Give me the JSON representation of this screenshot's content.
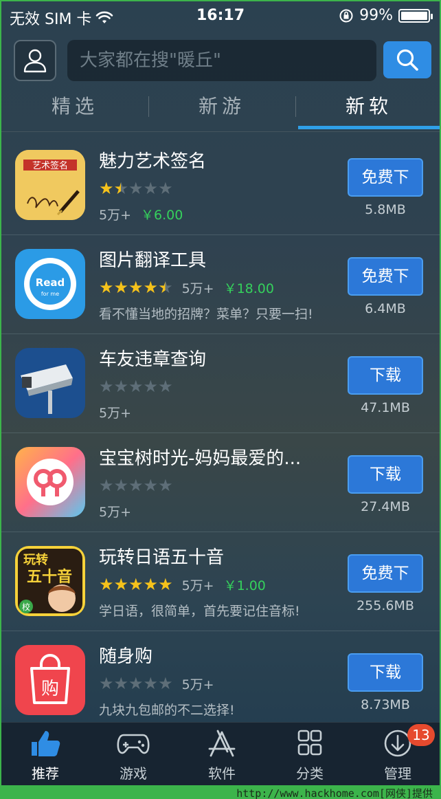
{
  "status": {
    "carrier": "无效 SIM 卡",
    "time": "16:17",
    "battery": "99%",
    "battery_level": 0.99
  },
  "search": {
    "placeholder": "大家都在搜\"暖丘\""
  },
  "tabs": [
    {
      "label": "精选",
      "active": false
    },
    {
      "label": "新游",
      "active": false
    },
    {
      "label": "新软",
      "active": true
    }
  ],
  "apps": [
    {
      "name": "魅力艺术签名",
      "rating": 1.5,
      "downloads": "5万+",
      "price": "￥6.00",
      "desc": "",
      "button": "免费下",
      "size": "5.8MB"
    },
    {
      "name": "图片翻译工具",
      "rating": 4.5,
      "downloads": "5万+",
      "price": "￥18.00",
      "desc": "看不懂当地的招牌？菜单？只要一扫!",
      "button": "免费下",
      "size": "6.4MB"
    },
    {
      "name": "车友违章查询",
      "rating": 0,
      "downloads": "5万+",
      "price": "",
      "desc": "",
      "button": "下载",
      "size": "47.1MB"
    },
    {
      "name": "宝宝树时光-妈妈最爱的...",
      "rating": 0,
      "downloads": "5万+",
      "price": "",
      "desc": "",
      "button": "下载",
      "size": "27.4MB"
    },
    {
      "name": "玩转日语五十音",
      "rating": 5,
      "downloads": "5万+",
      "price": "￥1.00",
      "desc": "学日语，很简单，首先要记住音标!",
      "button": "免费下",
      "size": "255.6MB"
    },
    {
      "name": "随身购",
      "rating": 0,
      "downloads": "5万+",
      "price": "",
      "desc": "九块九包邮的不二选择!",
      "button": "下载",
      "size": "8.73MB"
    }
  ],
  "icon_text": {
    "sign": "艺术签名",
    "read": "Read",
    "read_sub": "for me",
    "jp_top": "玩转",
    "jp_main": "五十音",
    "jp_badge": "校",
    "shop": "购"
  },
  "nav": [
    {
      "label": "推荐",
      "icon": "thumbs-up-icon",
      "active": true
    },
    {
      "label": "游戏",
      "icon": "gamepad-icon",
      "active": false
    },
    {
      "label": "软件",
      "icon": "app-store-icon",
      "active": false
    },
    {
      "label": "分类",
      "icon": "grid-icon",
      "active": false
    },
    {
      "label": "管理",
      "icon": "download-icon",
      "active": false,
      "badge": "13"
    }
  ],
  "watermark": "http://www.hackhome.com[网侠]提供",
  "colors": {
    "accent": "#2f8de4",
    "price": "#35d15c",
    "star": "#f5c21b",
    "badge": "#e64a2e"
  }
}
